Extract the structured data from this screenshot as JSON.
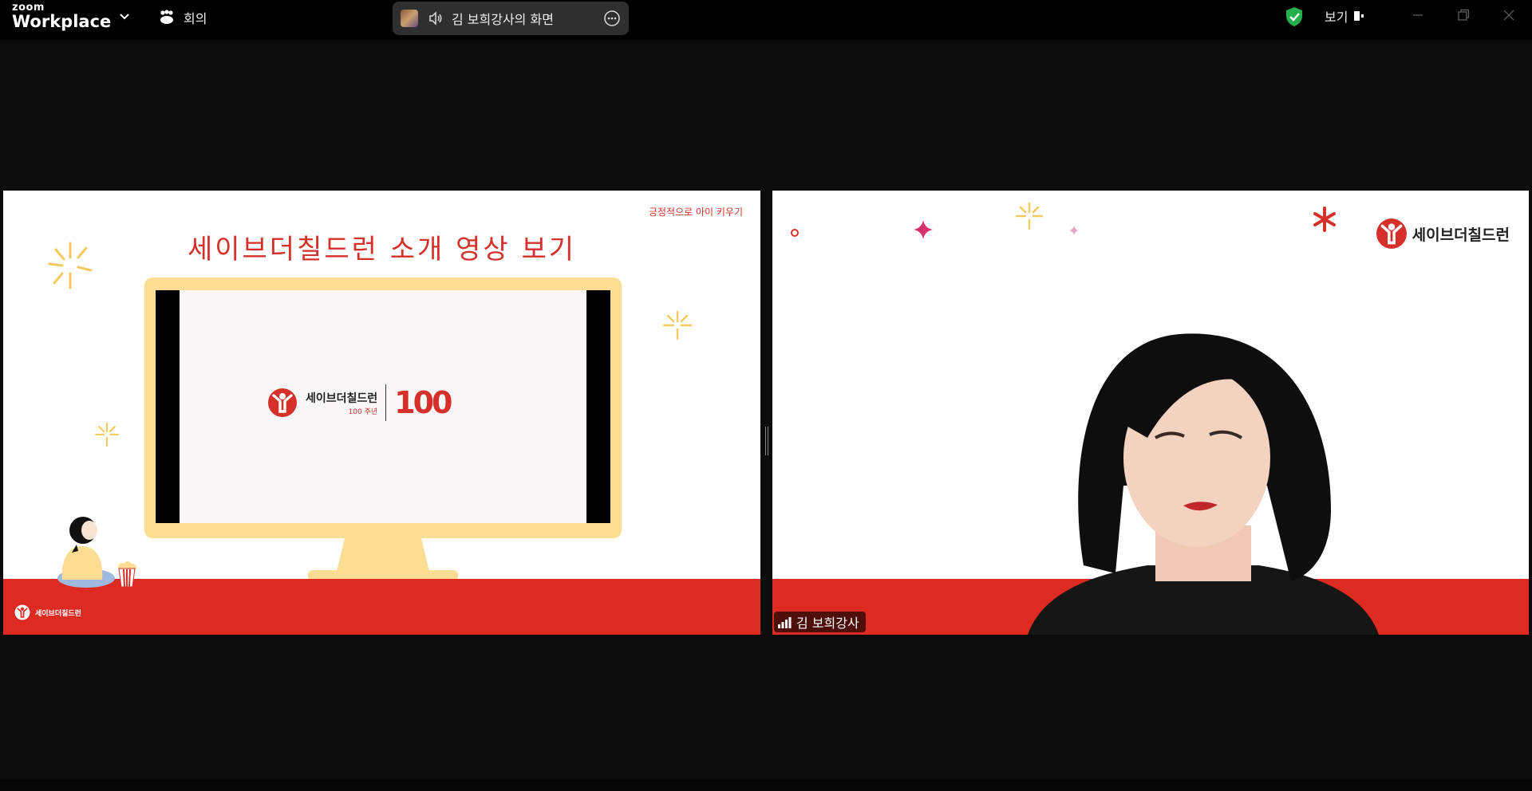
{
  "app": {
    "brand_top": "zoom",
    "brand_name": "Workplace",
    "meeting_label": "회의",
    "share_title": "김 보희강사의 화면",
    "view_label": "보기"
  },
  "left_tile": {
    "slide_tag": "긍정적으로 아이 키우기",
    "slide_title": "세이브더칠드런 소개 영상 보기",
    "screen_logo_name": "세이브더칠드런",
    "screen_logo_sub": "100 주년",
    "screen_logo_number": "100",
    "footer_logo": "세이브더칠드런"
  },
  "right_tile": {
    "logo_text": "세이브더칠드런",
    "participant_name": "김 보희강사"
  },
  "colors": {
    "brand_red": "#de2b22",
    "monitor_yellow": "#fddd93",
    "shield_green": "#22b14c"
  }
}
